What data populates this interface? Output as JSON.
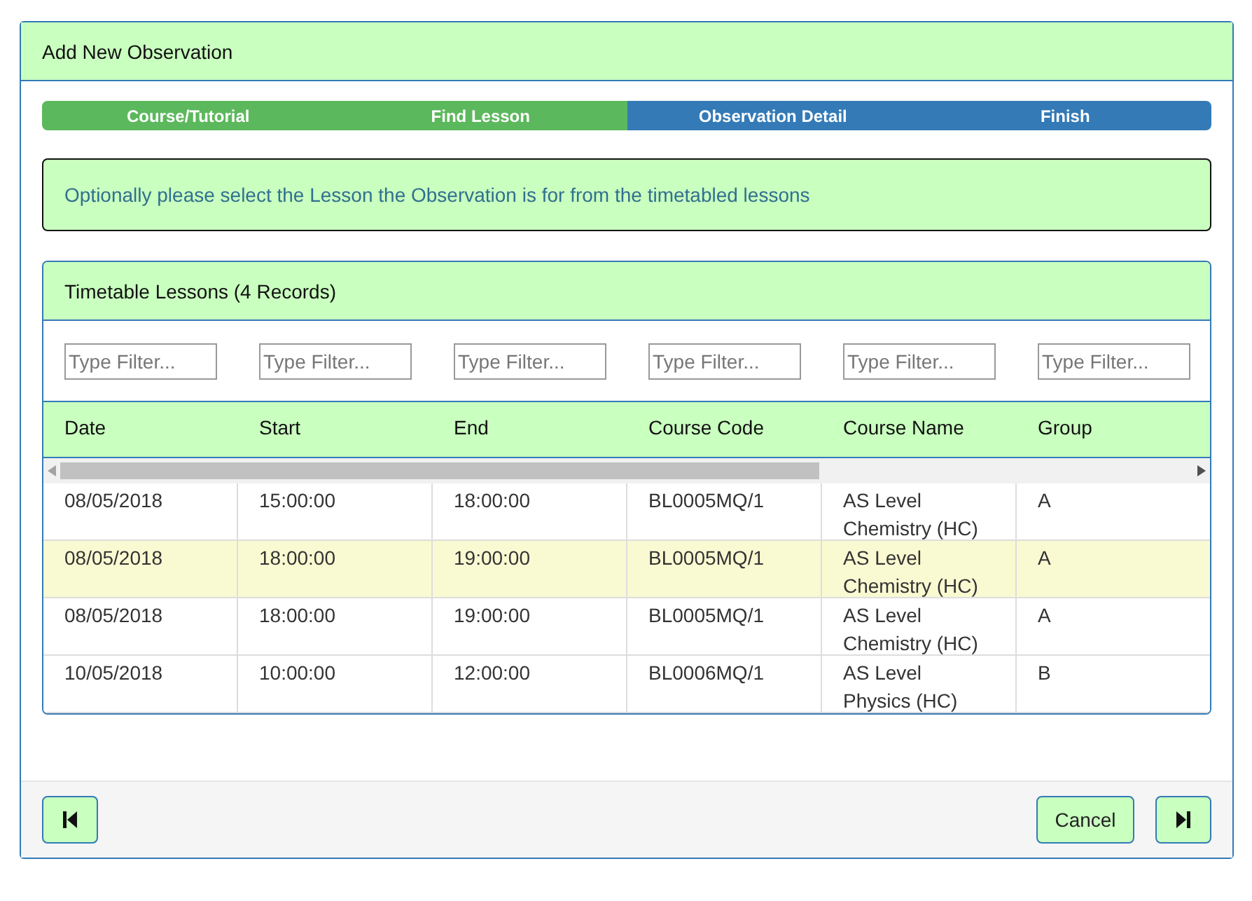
{
  "dialog": {
    "title": "Add New Observation"
  },
  "steps": [
    {
      "label": "Course/Tutorial",
      "completed": true
    },
    {
      "label": "Find Lesson",
      "completed": true
    },
    {
      "label": "Observation Detail",
      "completed": false
    },
    {
      "label": "Finish",
      "completed": false
    }
  ],
  "message": "Optionally please select the Lesson the Observation is for from the timetabled lessons",
  "panel": {
    "title": "Timetable Lessons (4 Records)"
  },
  "filters": [
    {
      "placeholder": "Type Filter..."
    },
    {
      "placeholder": "Type Filter..."
    },
    {
      "placeholder": "Type Filter..."
    },
    {
      "placeholder": "Type Filter..."
    },
    {
      "placeholder": "Type Filter..."
    },
    {
      "placeholder": "Type Filter..."
    }
  ],
  "columns": [
    "Date",
    "Start",
    "End",
    "Course Code",
    "Course Name",
    "Group"
  ],
  "rows": [
    {
      "cells": [
        "08/05/2018",
        "15:00:00",
        "18:00:00",
        "BL0005MQ/1",
        "AS Level Chemistry (HC)",
        "A"
      ],
      "selected": false
    },
    {
      "cells": [
        "08/05/2018",
        "18:00:00",
        "19:00:00",
        "BL0005MQ/1",
        "AS Level Chemistry (HC)",
        "A"
      ],
      "selected": true
    },
    {
      "cells": [
        "08/05/2018",
        "18:00:00",
        "19:00:00",
        "BL0005MQ/1",
        "AS Level Chemistry (HC)",
        "A"
      ],
      "selected": false
    },
    {
      "cells": [
        "10/05/2018",
        "10:00:00",
        "12:00:00",
        "BL0006MQ/1",
        "AS Level Physics (HC)",
        "B"
      ],
      "selected": false
    }
  ],
  "footer": {
    "cancel": "Cancel"
  }
}
